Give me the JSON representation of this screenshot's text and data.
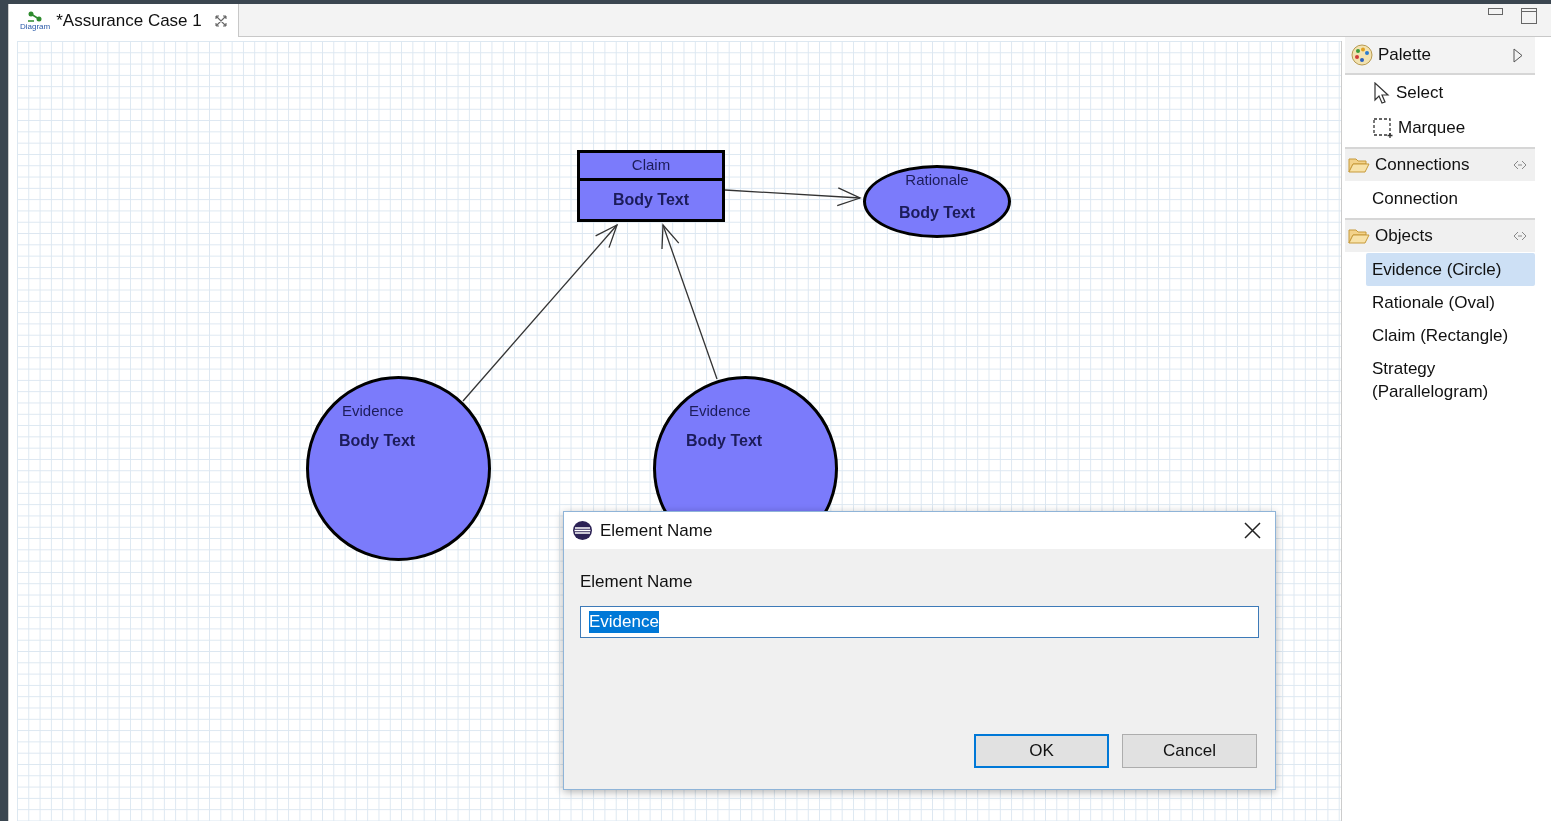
{
  "editor_tab": {
    "icon_caption": "Diagram",
    "title": "*Assurance Case 1",
    "dirty": true
  },
  "palette": {
    "title": "Palette",
    "tools": [
      {
        "kind": "select",
        "label": "Select"
      },
      {
        "kind": "marquee",
        "label": "Marquee"
      }
    ],
    "drawers": [
      {
        "title": "Connections",
        "items": [
          {
            "label": "Connection",
            "selected": false
          }
        ]
      },
      {
        "title": "Objects",
        "items": [
          {
            "label": "Evidence (Circle)",
            "selected": true
          },
          {
            "label": "Rationale (Oval)",
            "selected": false
          },
          {
            "label": "Claim (Rectangle)",
            "selected": false
          },
          {
            "label": "Strategy (Parallelogram)",
            "selected": false
          }
        ]
      }
    ]
  },
  "diagram": {
    "nodes": [
      {
        "kind": "rectangle",
        "name": "Claim",
        "body": "Body Text"
      },
      {
        "kind": "oval",
        "name": "Rationale",
        "body": "Body Text"
      },
      {
        "kind": "circle",
        "name": "Evidence",
        "body": "Body Text"
      },
      {
        "kind": "circle",
        "name": "Evidence",
        "body": "Body Text"
      }
    ]
  },
  "dialog": {
    "title": "Element Name",
    "field_label": "Element Name",
    "value": "Evidence",
    "value_selected": true,
    "buttons": [
      {
        "label": "OK",
        "default": true
      },
      {
        "label": "Cancel",
        "default": false
      }
    ]
  }
}
